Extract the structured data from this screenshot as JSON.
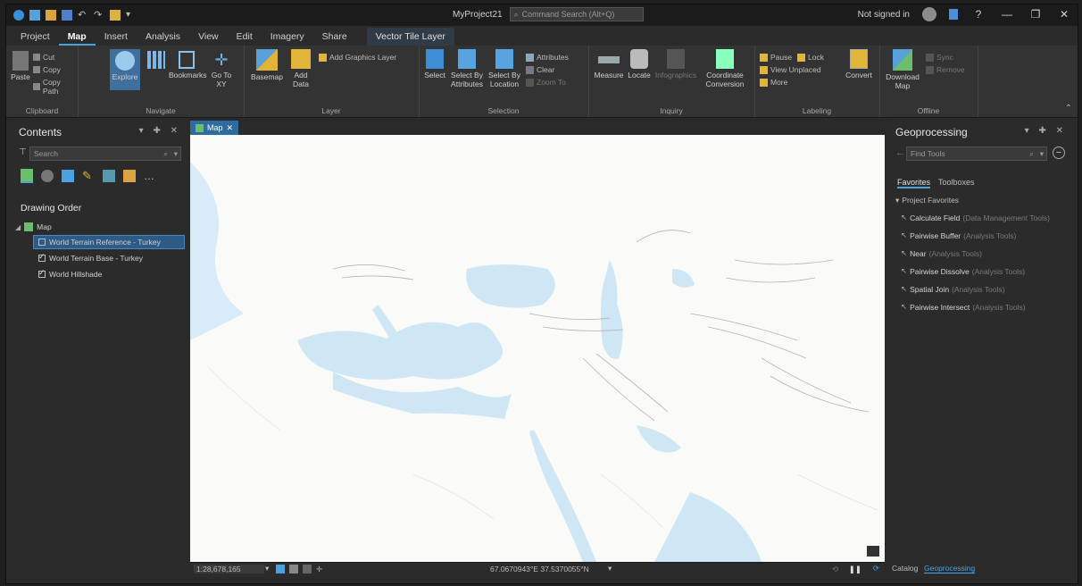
{
  "window": {
    "project_title": "MyProject21",
    "command_search_placeholder": "Command Search (Alt+Q)",
    "signin_text": "Not signed in",
    "help_label": "?",
    "minimize": "—",
    "restore": "❐",
    "close": "✕"
  },
  "ribbon_tabs": [
    "Project",
    "Map",
    "Insert",
    "Analysis",
    "View",
    "Edit",
    "Imagery",
    "Share",
    "Vector Tile Layer"
  ],
  "ribbon": {
    "clipboard": {
      "paste": "Paste",
      "cut": "Cut",
      "copy": "Copy",
      "copy_path": "Copy Path",
      "label": "Clipboard"
    },
    "navigate": {
      "explore": "Explore",
      "bookmarks": "Bookmarks",
      "go_to_xy": "Go To XY",
      "label": "Navigate"
    },
    "layer": {
      "basemap": "Basemap",
      "add_data": "Add Data",
      "add_graphics_layer": "Add Graphics Layer",
      "label": "Layer"
    },
    "selection": {
      "select": "Select",
      "select_by_attributes": "Select By Attributes",
      "select_by_location": "Select By Location",
      "attributes": "Attributes",
      "clear": "Clear",
      "zoom_to": "Zoom To",
      "label": "Selection"
    },
    "inquiry": {
      "measure": "Measure",
      "locate": "Locate",
      "infographics": "Infographics",
      "coordinate_conversion": "Coordinate Conversion",
      "label": "Inquiry"
    },
    "labeling": {
      "pause": "Pause",
      "lock": "Lock",
      "view_unplaced": "View Unplaced",
      "more": "More",
      "convert": "Convert",
      "label": "Labeling"
    },
    "offline": {
      "download_map": "Download Map",
      "sync": "Sync",
      "remove": "Remove",
      "label": "Offline"
    }
  },
  "contents": {
    "title": "Contents",
    "search_placeholder": "Search",
    "drawing_order": "Drawing Order",
    "map_name": "Map",
    "layers": [
      {
        "name": "World Terrain Reference - Turkey",
        "checked": false,
        "selected": true
      },
      {
        "name": "World Terrain Base - Turkey",
        "checked": true,
        "selected": false
      },
      {
        "name": "World Hillshade",
        "checked": true,
        "selected": false
      }
    ]
  },
  "map": {
    "tab_label": "Map",
    "scale": "1:28,678,165",
    "coordinates": "67.0670943°E 37.5370055°N"
  },
  "geoprocessing": {
    "title": "Geoprocessing",
    "search_placeholder": "Find Tools",
    "tabs": [
      "Favorites",
      "Toolboxes"
    ],
    "section": "Project Favorites",
    "tools": [
      {
        "name": "Calculate Field",
        "toolbox": "(Data Management Tools)"
      },
      {
        "name": "Pairwise Buffer",
        "toolbox": "(Analysis Tools)"
      },
      {
        "name": "Near",
        "toolbox": "(Analysis Tools)"
      },
      {
        "name": "Pairwise Dissolve",
        "toolbox": "(Analysis Tools)"
      },
      {
        "name": "Spatial Join",
        "toolbox": "(Analysis Tools)"
      },
      {
        "name": "Pairwise Intersect",
        "toolbox": "(Analysis Tools)"
      }
    ],
    "bottom_tabs": [
      "Catalog",
      "Geoprocessing"
    ]
  },
  "colors": {
    "accent": "#4aa3e0",
    "selected_row": "#2e5a86",
    "water": "#cfe6f5"
  }
}
